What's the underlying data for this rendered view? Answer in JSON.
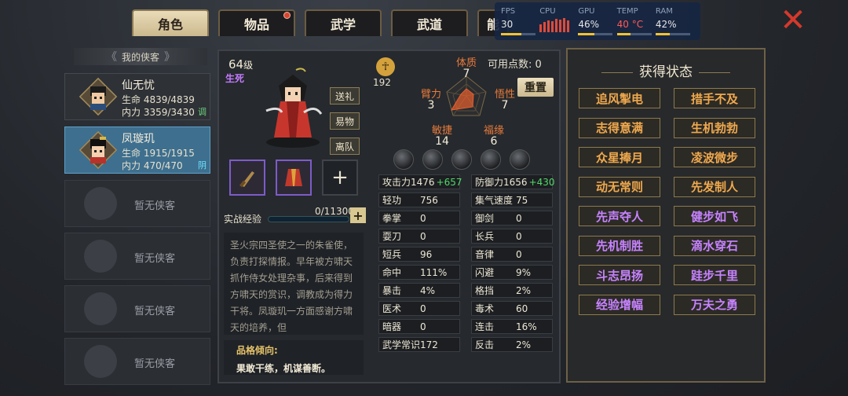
{
  "tabs": [
    {
      "label": "角色",
      "active": true
    },
    {
      "label": "物品",
      "badge": true
    },
    {
      "label": "武学"
    },
    {
      "label": "武道"
    },
    {
      "label": "能"
    }
  ],
  "perf": {
    "fps_label": "FPS",
    "fps": "30",
    "cpu_label": "CPU",
    "gpu_label": "GPU",
    "gpu": "46%",
    "temp_label": "TEMP",
    "temp": "40 °C",
    "ram_label": "RAM",
    "ram": "42%"
  },
  "left": {
    "header": "我的侠客",
    "heroes": [
      {
        "name": "仙无忧",
        "hp": "生命 4839/4839",
        "mp": "内力 3359/3430",
        "tag": "调"
      },
      {
        "name": "凤璇玑",
        "hp": "生命 1915/1915",
        "mp": "内力 470/470",
        "tag": "阴"
      }
    ],
    "empty_label": "暂无侠客"
  },
  "character": {
    "level": "64",
    "level_unit": "级",
    "fate": "生死",
    "actions": [
      "送礼",
      "易物",
      "离队"
    ],
    "exp_label": "实战经验",
    "exp_value": "0/11300",
    "exp_progress": 0,
    "description": "圣火宗四圣使之一的朱雀使，负责打探情报。早年被方啸天抓作侍女处理杂事，后来得到方啸天的赏识，调教成为得力干将。凤璇玑一方面感谢方啸天的培养，但",
    "trait_title": "品格倾向:",
    "trait_text": "果敢干练，机谋善断。",
    "power": "192"
  },
  "attributes": {
    "points_label": "可用点数:",
    "points": "0",
    "reset_label": "重置",
    "items": [
      {
        "name": "体质",
        "value": "7"
      },
      {
        "name": "悟性",
        "value": "7"
      },
      {
        "name": "福缘",
        "value": "6"
      },
      {
        "name": "敏捷",
        "value": "14"
      },
      {
        "name": "臂力",
        "value": "3"
      }
    ]
  },
  "stats": [
    [
      {
        "k": "攻击力",
        "v": "1476",
        "b": "+657"
      },
      {
        "k": "防御力",
        "v": "1656",
        "b": "+430"
      }
    ],
    [
      {
        "k": "轻功",
        "v": "756"
      },
      {
        "k": "集气速度",
        "v": "75"
      }
    ],
    [
      {
        "k": "拳掌",
        "v": "0"
      },
      {
        "k": "御剑",
        "v": "0"
      }
    ],
    [
      {
        "k": "耍刀",
        "v": "0"
      },
      {
        "k": "长兵",
        "v": "0"
      }
    ],
    [
      {
        "k": "短兵",
        "v": "96"
      },
      {
        "k": "音律",
        "v": "0"
      }
    ],
    [
      {
        "k": "命中",
        "v": "111%"
      },
      {
        "k": "闪避",
        "v": "9%"
      }
    ],
    [
      {
        "k": "暴击",
        "v": "4%"
      },
      {
        "k": "格挡",
        "v": "2%"
      }
    ],
    [
      {
        "k": "医术",
        "v": "0"
      },
      {
        "k": "毒术",
        "v": "60"
      }
    ],
    [
      {
        "k": "暗器",
        "v": "0"
      },
      {
        "k": "连击",
        "v": "16%"
      }
    ],
    [
      {
        "k": "武学常识",
        "v": "172"
      },
      {
        "k": "反击",
        "v": "2%"
      }
    ]
  ],
  "status": {
    "title": "获得状态",
    "items": [
      {
        "label": "追风掣电",
        "color": "orange"
      },
      {
        "label": "措手不及",
        "color": "orange"
      },
      {
        "label": "志得意满",
        "color": "orange"
      },
      {
        "label": "生机勃勃",
        "color": "orange"
      },
      {
        "label": "众星捧月",
        "color": "orange"
      },
      {
        "label": "凌波微步",
        "color": "orange"
      },
      {
        "label": "动无常则",
        "color": "orange"
      },
      {
        "label": "先发制人",
        "color": "orange"
      },
      {
        "label": "先声夺人",
        "color": "purple"
      },
      {
        "label": "健步如飞",
        "color": "purple"
      },
      {
        "label": "先机制胜",
        "color": "purple"
      },
      {
        "label": "滴水穿石",
        "color": "purple"
      },
      {
        "label": "斗志昂扬",
        "color": "purple"
      },
      {
        "label": "跬步千里",
        "color": "purple"
      },
      {
        "label": "经验增幅",
        "color": "purple"
      },
      {
        "label": "万夫之勇",
        "color": "purple"
      }
    ]
  }
}
